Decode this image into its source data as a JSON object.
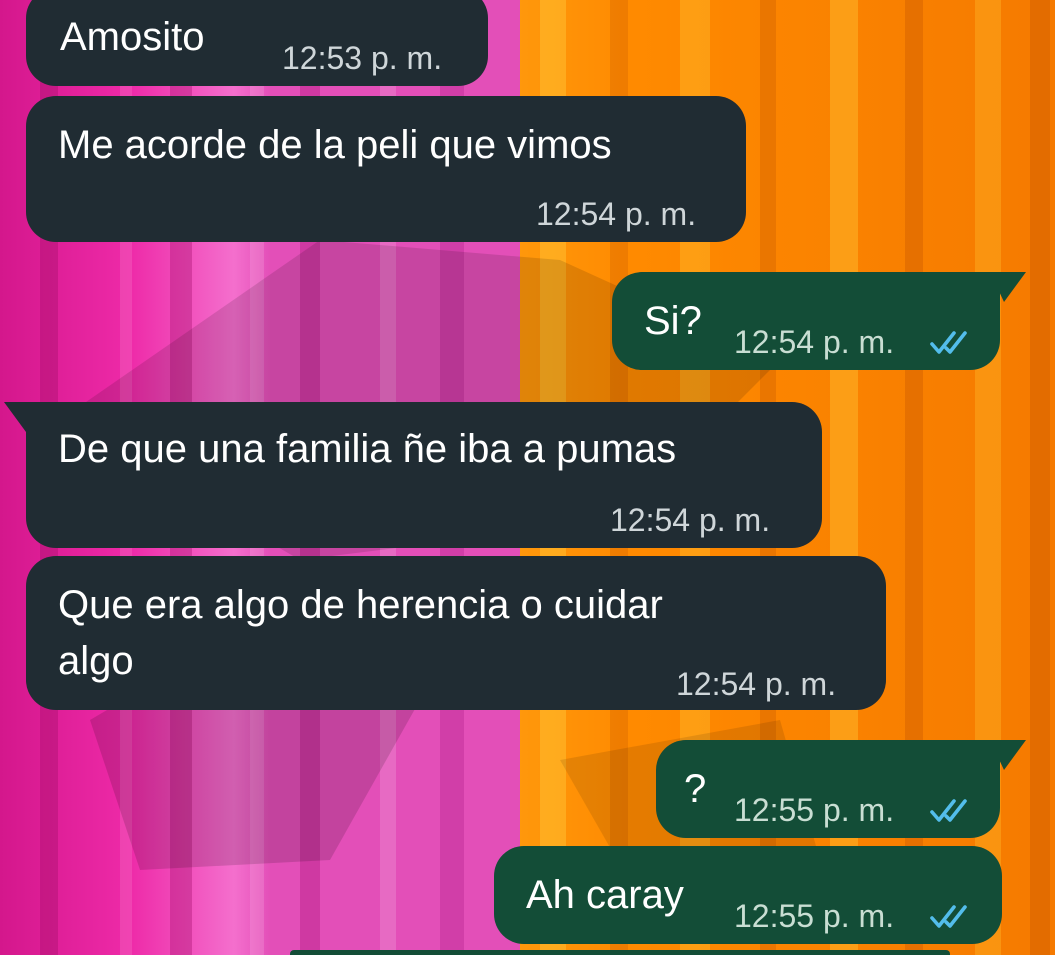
{
  "chat": {
    "messages": [
      {
        "direction": "incoming",
        "text": "Amosito",
        "time": "12:53 p. m."
      },
      {
        "direction": "incoming",
        "text": "Me acorde de la peli que vimos",
        "time": "12:54 p. m."
      },
      {
        "direction": "outgoing",
        "text": "Si?",
        "time": "12:54 p. m.",
        "status_icon": "double-check-read-icon"
      },
      {
        "direction": "incoming",
        "text": "De que una familia ñe iba a pumas",
        "time": "12:54 p. m."
      },
      {
        "direction": "incoming",
        "text_line1": "Que era algo de herencia o cuidar",
        "text_line2": "algo",
        "time": "12:54 p. m."
      },
      {
        "direction": "outgoing",
        "text": "?",
        "time": "12:55 p. m.",
        "status_icon": "double-check-read-icon"
      },
      {
        "direction": "outgoing",
        "text": "Ah caray",
        "time": "12:55 p. m.",
        "status_icon": "double-check-read-icon"
      }
    ]
  },
  "colors": {
    "incoming_bubble": "#202c33",
    "outgoing_bubble": "#134d37",
    "read_ticks": "#53bdeb",
    "wallpaper_pink": "#e0239b",
    "wallpaper_orange": "#ff8c00"
  }
}
